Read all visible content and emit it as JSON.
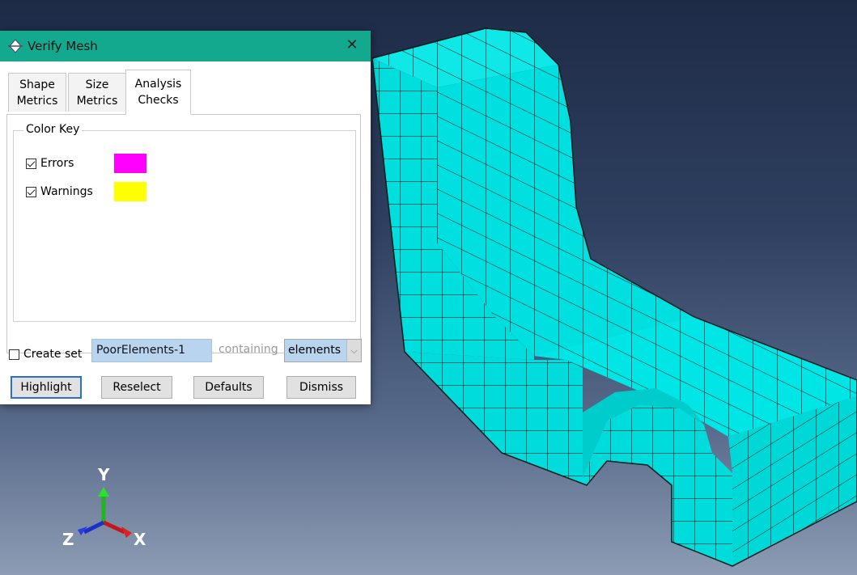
{
  "dialog": {
    "title": "Verify Mesh",
    "tabs": [
      {
        "line1": "Shape",
        "line2": "Metrics"
      },
      {
        "line1": "Size",
        "line2": "Metrics"
      },
      {
        "line1": "Analysis",
        "line2": "Checks"
      }
    ],
    "active_tab": "Analysis Checks",
    "color_key": {
      "label": "Color Key",
      "items": [
        {
          "label": "Errors",
          "checked": true,
          "color": "#ff00ff"
        },
        {
          "label": "Warnings",
          "checked": true,
          "color": "#ffff00"
        }
      ]
    },
    "create_set": {
      "label": "Create set",
      "checked": false,
      "value": "PoorElements-1",
      "containing_label": "containing",
      "containing_value": "elements"
    },
    "buttons": {
      "highlight": "Highlight",
      "reselect": "Reselect",
      "defaults": "Defaults",
      "dismiss": "Dismiss"
    }
  },
  "triad": {
    "x": "X",
    "y": "Y",
    "z": "Z"
  },
  "colors": {
    "titlebar": "#13a98f",
    "mesh_fill": "#00e6e6",
    "mesh_lines": "#0a2b2b",
    "bg_top": "#1e2b47",
    "bg_bottom": "#8d9cb4"
  }
}
